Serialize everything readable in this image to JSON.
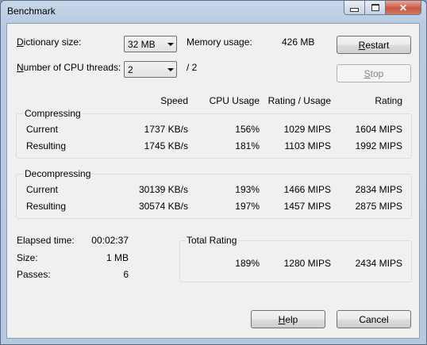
{
  "window": {
    "title": "Benchmark"
  },
  "settings": {
    "dictionary_label_pre": "D",
    "dictionary_label_rest": "ictionary size:",
    "dictionary_value": "32 MB",
    "memory_label": "Memory usage:",
    "memory_value": "426 MB",
    "threads_label_pre": "N",
    "threads_label_rest": "umber of CPU threads:",
    "threads_value": "2",
    "threads_total": "/ 2"
  },
  "buttons": {
    "restart_pre": "R",
    "restart_rest": "estart",
    "stop_pre": "S",
    "stop_rest": "top",
    "help_pre": "H",
    "help_rest": "elp",
    "cancel": "Cancel"
  },
  "columns": {
    "speed": "Speed",
    "cpu": "CPU Usage",
    "rating_usage": "Rating / Usage",
    "rating": "Rating"
  },
  "compressing": {
    "title": "Compressing",
    "rows": [
      {
        "label": "Current",
        "speed": "1737 KB/s",
        "cpu": "156%",
        "rating_usage": "1029 MIPS",
        "rating": "1604 MIPS"
      },
      {
        "label": "Resulting",
        "speed": "1745 KB/s",
        "cpu": "181%",
        "rating_usage": "1103 MIPS",
        "rating": "1992 MIPS"
      }
    ]
  },
  "decompressing": {
    "title": "Decompressing",
    "rows": [
      {
        "label": "Current",
        "speed": "30139 KB/s",
        "cpu": "193%",
        "rating_usage": "1466 MIPS",
        "rating": "2834 MIPS"
      },
      {
        "label": "Resulting",
        "speed": "30574 KB/s",
        "cpu": "197%",
        "rating_usage": "1457 MIPS",
        "rating": "2875 MIPS"
      }
    ]
  },
  "stats": {
    "elapsed_label": "Elapsed time:",
    "elapsed_value": "00:02:37",
    "size_label": "Size:",
    "size_value": "1 MB",
    "passes_label": "Passes:",
    "passes_value": "6"
  },
  "total": {
    "title": "Total Rating",
    "cpu": "189%",
    "rating_usage": "1280 MIPS",
    "rating": "2434 MIPS"
  }
}
